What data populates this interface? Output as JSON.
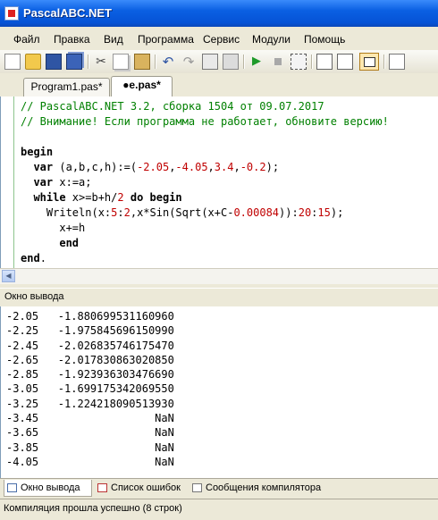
{
  "window": {
    "title": "PascalABC.NET"
  },
  "menu": [
    "Файл",
    "Правка",
    "Вид",
    "Программа",
    "Сервис",
    "Модули",
    "Помощь"
  ],
  "tabs": [
    {
      "label": "Program1.pas*",
      "active": false
    },
    {
      "label": "●e.pas*",
      "active": true
    }
  ],
  "code": [
    [
      {
        "t": "// PascalABC.NET 3.2, сборка 1504 от 09.07.2017",
        "c": "cm"
      }
    ],
    [
      {
        "t": "// Внимание! Если программа не работает, обновите версию!",
        "c": "cm"
      }
    ],
    [],
    [
      {
        "t": "begin",
        "c": "kw"
      }
    ],
    [
      {
        "t": "  "
      },
      {
        "t": "var",
        "c": "kw"
      },
      {
        "t": " (a,b,c,h):=("
      },
      {
        "t": "-2.05",
        "c": "nm"
      },
      {
        "t": ","
      },
      {
        "t": "-4.05",
        "c": "nm"
      },
      {
        "t": ","
      },
      {
        "t": "3.4",
        "c": "nm"
      },
      {
        "t": ","
      },
      {
        "t": "-0.2",
        "c": "nm"
      },
      {
        "t": ");"
      }
    ],
    [
      {
        "t": "  "
      },
      {
        "t": "var",
        "c": "kw"
      },
      {
        "t": " x:=a;"
      }
    ],
    [
      {
        "t": "  "
      },
      {
        "t": "while",
        "c": "kw"
      },
      {
        "t": " x>=b+h/"
      },
      {
        "t": "2",
        "c": "nm"
      },
      {
        "t": " "
      },
      {
        "t": "do",
        "c": "kw"
      },
      {
        "t": " "
      },
      {
        "t": "begin",
        "c": "kw"
      }
    ],
    [
      {
        "t": "    Writeln(x:"
      },
      {
        "t": "5",
        "c": "nm"
      },
      {
        "t": ":"
      },
      {
        "t": "2",
        "c": "nm"
      },
      {
        "t": ",x*Sin(Sqrt(x+C-"
      },
      {
        "t": "0.00084",
        "c": "nm"
      },
      {
        "t": ")):"
      },
      {
        "t": "20",
        "c": "nm"
      },
      {
        "t": ":"
      },
      {
        "t": "15",
        "c": "nm"
      },
      {
        "t": ");"
      }
    ],
    [
      {
        "t": "      x+=h"
      }
    ],
    [
      {
        "t": "      "
      },
      {
        "t": "end",
        "c": "kw"
      }
    ],
    [
      {
        "t": "end",
        "c": "kw"
      },
      {
        "t": "."
      }
    ]
  ],
  "output_panel": {
    "title": "Окно вывода"
  },
  "output_lines": [
    "-2.05   -1.880699531160960",
    "-2.25   -1.975845696150990",
    "-2.45   -2.026835746175470",
    "-2.65   -2.017830863020850",
    "-2.85   -1.923936303476690",
    "-3.05   -1.699175342069550",
    "-3.25   -1.224218090513930",
    "-3.45                  NaN",
    "-3.65                  NaN",
    "-3.85                  NaN",
    "-4.05                  NaN"
  ],
  "bottom_tabs": [
    {
      "label": "Окно вывода",
      "icon": "output-window-icon",
      "active": true
    },
    {
      "label": "Список ошибок",
      "icon": "error-list-icon",
      "active": false
    },
    {
      "label": "Сообщения компилятора",
      "icon": "compiler-messages-icon",
      "active": false
    }
  ],
  "status": {
    "text": "Компиляция прошла успешно (8 строк)"
  },
  "toolbar_icons": [
    "new-file-icon",
    "open-folder-icon",
    "save-icon",
    "save-all-icon",
    "cut-icon",
    "copy-icon",
    "paste-icon",
    "undo-icon",
    "redo-icon",
    "compile-icon",
    "debug-icon",
    "run-icon",
    "stop-icon",
    "form-designer-icon",
    "step-over-icon",
    "step-into-icon",
    "output-panel-icon",
    "properties-icon"
  ]
}
